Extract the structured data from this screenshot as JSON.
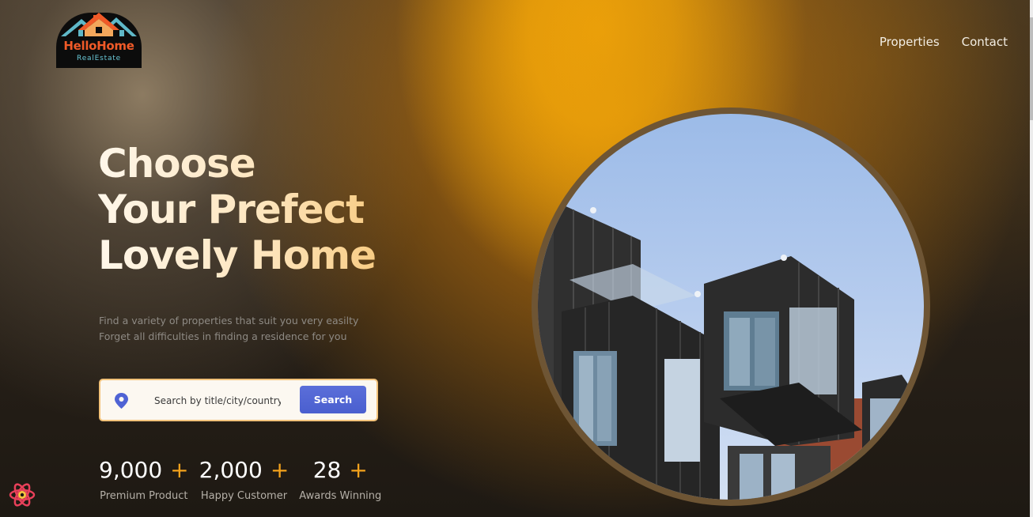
{
  "logo": {
    "brand": "HelloHome",
    "subtitle": "RealEstate",
    "icon": "house-roof-logo-icon"
  },
  "nav": [
    {
      "label": "Properties"
    },
    {
      "label": "Contact"
    }
  ],
  "hero": {
    "headline_lines": [
      "Choose",
      "Your Prefect",
      "Lovely Home"
    ],
    "tagline_lines": [
      "Find a variety of properties that suit you very easilty",
      "Forget all difficulties in finding a residence for you"
    ]
  },
  "search": {
    "icon": "location-pin-icon",
    "placeholder": "Search by title/city/country",
    "button_label": "Search"
  },
  "stats": [
    {
      "value": "9,000",
      "suffix": "+",
      "label": "Premium Product"
    },
    {
      "value": "2,000",
      "suffix": "+",
      "label": "Happy Customer"
    },
    {
      "value": "28",
      "suffix": "+",
      "label": "Awards Winning"
    }
  ],
  "colors": {
    "accent_orange": "#f3a21c",
    "search_button": "#4f63d4",
    "pin_blue": "#4f63d4"
  },
  "corner_icon": "react-dev-icon"
}
